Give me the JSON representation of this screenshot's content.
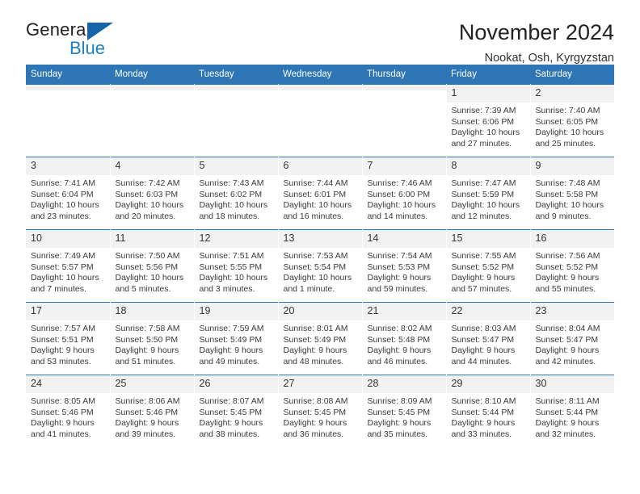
{
  "brand": {
    "name_top": "General",
    "name_bottom": "Blue",
    "triangle_color": "#1565a8",
    "blue_color": "#1f7fc4"
  },
  "header": {
    "title": "November 2024",
    "subtitle": "Nookat, Osh, Kyrgyzstan",
    "accent_color": "#2e75b6"
  },
  "calendar": {
    "weekday_headers": [
      "Sunday",
      "Monday",
      "Tuesday",
      "Wednesday",
      "Thursday",
      "Friday",
      "Saturday"
    ],
    "weeks": [
      [
        {
          "day": "",
          "sunrise": "",
          "sunset": "",
          "daylight_1": "",
          "daylight_2": ""
        },
        {
          "day": "",
          "sunrise": "",
          "sunset": "",
          "daylight_1": "",
          "daylight_2": ""
        },
        {
          "day": "",
          "sunrise": "",
          "sunset": "",
          "daylight_1": "",
          "daylight_2": ""
        },
        {
          "day": "",
          "sunrise": "",
          "sunset": "",
          "daylight_1": "",
          "daylight_2": ""
        },
        {
          "day": "",
          "sunrise": "",
          "sunset": "",
          "daylight_1": "",
          "daylight_2": ""
        },
        {
          "day": "1",
          "sunrise": "Sunrise: 7:39 AM",
          "sunset": "Sunset: 6:06 PM",
          "daylight_1": "Daylight: 10 hours",
          "daylight_2": "and 27 minutes."
        },
        {
          "day": "2",
          "sunrise": "Sunrise: 7:40 AM",
          "sunset": "Sunset: 6:05 PM",
          "daylight_1": "Daylight: 10 hours",
          "daylight_2": "and 25 minutes."
        }
      ],
      [
        {
          "day": "3",
          "sunrise": "Sunrise: 7:41 AM",
          "sunset": "Sunset: 6:04 PM",
          "daylight_1": "Daylight: 10 hours",
          "daylight_2": "and 23 minutes."
        },
        {
          "day": "4",
          "sunrise": "Sunrise: 7:42 AM",
          "sunset": "Sunset: 6:03 PM",
          "daylight_1": "Daylight: 10 hours",
          "daylight_2": "and 20 minutes."
        },
        {
          "day": "5",
          "sunrise": "Sunrise: 7:43 AM",
          "sunset": "Sunset: 6:02 PM",
          "daylight_1": "Daylight: 10 hours",
          "daylight_2": "and 18 minutes."
        },
        {
          "day": "6",
          "sunrise": "Sunrise: 7:44 AM",
          "sunset": "Sunset: 6:01 PM",
          "daylight_1": "Daylight: 10 hours",
          "daylight_2": "and 16 minutes."
        },
        {
          "day": "7",
          "sunrise": "Sunrise: 7:46 AM",
          "sunset": "Sunset: 6:00 PM",
          "daylight_1": "Daylight: 10 hours",
          "daylight_2": "and 14 minutes."
        },
        {
          "day": "8",
          "sunrise": "Sunrise: 7:47 AM",
          "sunset": "Sunset: 5:59 PM",
          "daylight_1": "Daylight: 10 hours",
          "daylight_2": "and 12 minutes."
        },
        {
          "day": "9",
          "sunrise": "Sunrise: 7:48 AM",
          "sunset": "Sunset: 5:58 PM",
          "daylight_1": "Daylight: 10 hours",
          "daylight_2": "and 9 minutes."
        }
      ],
      [
        {
          "day": "10",
          "sunrise": "Sunrise: 7:49 AM",
          "sunset": "Sunset: 5:57 PM",
          "daylight_1": "Daylight: 10 hours",
          "daylight_2": "and 7 minutes."
        },
        {
          "day": "11",
          "sunrise": "Sunrise: 7:50 AM",
          "sunset": "Sunset: 5:56 PM",
          "daylight_1": "Daylight: 10 hours",
          "daylight_2": "and 5 minutes."
        },
        {
          "day": "12",
          "sunrise": "Sunrise: 7:51 AM",
          "sunset": "Sunset: 5:55 PM",
          "daylight_1": "Daylight: 10 hours",
          "daylight_2": "and 3 minutes."
        },
        {
          "day": "13",
          "sunrise": "Sunrise: 7:53 AM",
          "sunset": "Sunset: 5:54 PM",
          "daylight_1": "Daylight: 10 hours",
          "daylight_2": "and 1 minute."
        },
        {
          "day": "14",
          "sunrise": "Sunrise: 7:54 AM",
          "sunset": "Sunset: 5:53 PM",
          "daylight_1": "Daylight: 9 hours",
          "daylight_2": "and 59 minutes."
        },
        {
          "day": "15",
          "sunrise": "Sunrise: 7:55 AM",
          "sunset": "Sunset: 5:52 PM",
          "daylight_1": "Daylight: 9 hours",
          "daylight_2": "and 57 minutes."
        },
        {
          "day": "16",
          "sunrise": "Sunrise: 7:56 AM",
          "sunset": "Sunset: 5:52 PM",
          "daylight_1": "Daylight: 9 hours",
          "daylight_2": "and 55 minutes."
        }
      ],
      [
        {
          "day": "17",
          "sunrise": "Sunrise: 7:57 AM",
          "sunset": "Sunset: 5:51 PM",
          "daylight_1": "Daylight: 9 hours",
          "daylight_2": "and 53 minutes."
        },
        {
          "day": "18",
          "sunrise": "Sunrise: 7:58 AM",
          "sunset": "Sunset: 5:50 PM",
          "daylight_1": "Daylight: 9 hours",
          "daylight_2": "and 51 minutes."
        },
        {
          "day": "19",
          "sunrise": "Sunrise: 7:59 AM",
          "sunset": "Sunset: 5:49 PM",
          "daylight_1": "Daylight: 9 hours",
          "daylight_2": "and 49 minutes."
        },
        {
          "day": "20",
          "sunrise": "Sunrise: 8:01 AM",
          "sunset": "Sunset: 5:49 PM",
          "daylight_1": "Daylight: 9 hours",
          "daylight_2": "and 48 minutes."
        },
        {
          "day": "21",
          "sunrise": "Sunrise: 8:02 AM",
          "sunset": "Sunset: 5:48 PM",
          "daylight_1": "Daylight: 9 hours",
          "daylight_2": "and 46 minutes."
        },
        {
          "day": "22",
          "sunrise": "Sunrise: 8:03 AM",
          "sunset": "Sunset: 5:47 PM",
          "daylight_1": "Daylight: 9 hours",
          "daylight_2": "and 44 minutes."
        },
        {
          "day": "23",
          "sunrise": "Sunrise: 8:04 AM",
          "sunset": "Sunset: 5:47 PM",
          "daylight_1": "Daylight: 9 hours",
          "daylight_2": "and 42 minutes."
        }
      ],
      [
        {
          "day": "24",
          "sunrise": "Sunrise: 8:05 AM",
          "sunset": "Sunset: 5:46 PM",
          "daylight_1": "Daylight: 9 hours",
          "daylight_2": "and 41 minutes."
        },
        {
          "day": "25",
          "sunrise": "Sunrise: 8:06 AM",
          "sunset": "Sunset: 5:46 PM",
          "daylight_1": "Daylight: 9 hours",
          "daylight_2": "and 39 minutes."
        },
        {
          "day": "26",
          "sunrise": "Sunrise: 8:07 AM",
          "sunset": "Sunset: 5:45 PM",
          "daylight_1": "Daylight: 9 hours",
          "daylight_2": "and 38 minutes."
        },
        {
          "day": "27",
          "sunrise": "Sunrise: 8:08 AM",
          "sunset": "Sunset: 5:45 PM",
          "daylight_1": "Daylight: 9 hours",
          "daylight_2": "and 36 minutes."
        },
        {
          "day": "28",
          "sunrise": "Sunrise: 8:09 AM",
          "sunset": "Sunset: 5:45 PM",
          "daylight_1": "Daylight: 9 hours",
          "daylight_2": "and 35 minutes."
        },
        {
          "day": "29",
          "sunrise": "Sunrise: 8:10 AM",
          "sunset": "Sunset: 5:44 PM",
          "daylight_1": "Daylight: 9 hours",
          "daylight_2": "and 33 minutes."
        },
        {
          "day": "30",
          "sunrise": "Sunrise: 8:11 AM",
          "sunset": "Sunset: 5:44 PM",
          "daylight_1": "Daylight: 9 hours",
          "daylight_2": "and 32 minutes."
        }
      ]
    ]
  }
}
